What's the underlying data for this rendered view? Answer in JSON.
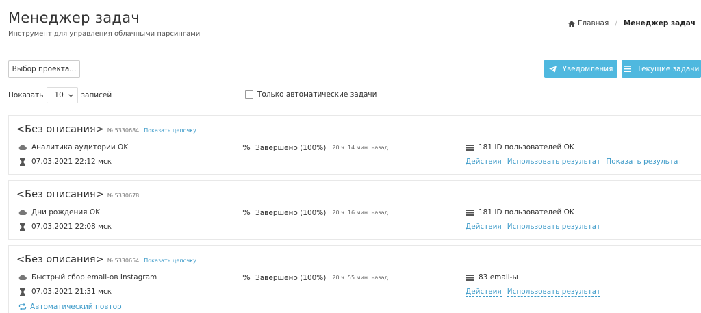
{
  "header": {
    "title": "Менеджер задач",
    "subtitle": "Инструмент для управления облачными парсингами",
    "breadcrumb": {
      "home": "Главная",
      "current": "Менеджер задач"
    }
  },
  "toolbar": {
    "project_button": "Выбор проекта...",
    "notifications_button": "Уведомления",
    "current_tasks_button": "Текущие задачи",
    "show_label": "Показать",
    "page_size": "10",
    "records_label": "записей",
    "auto_only_label": "Только автоматические задачи",
    "accent_color": "#4fb8df",
    "link_color": "#3e9bc9"
  },
  "tasks": [
    {
      "title": "<Без описания>",
      "number": "№ 5330684",
      "chain_link": "Показать цепочку",
      "tool": "Аналитика аудитории OK",
      "status": "Завершено (100%)",
      "ago": "20 ч. 14 мин. назад",
      "result": "181 ID пользователей OK",
      "datetime": "07.03.2021 22:12 мск",
      "actions": [
        "Действия",
        "Использовать результат",
        "Показать результат"
      ]
    },
    {
      "title": "<Без описания>",
      "number": "№ 5330678",
      "tool": "Дни рождения OK",
      "status": "Завершено (100%)",
      "ago": "20 ч. 16 мин. назад",
      "result": "181 ID пользователей OK",
      "datetime": "07.03.2021 22:08 мск",
      "actions": [
        "Действия",
        "Использовать результат"
      ]
    },
    {
      "title": "<Без описания>",
      "number": "№ 5330654",
      "chain_link": "Показать цепочку",
      "tool": "Быстрый сбор email-ов Instagram",
      "status": "Завершено (100%)",
      "ago": "20 ч. 55 мин. назад",
      "result": "83 email-ы",
      "datetime": "07.03.2021 21:31 мск",
      "actions": [
        "Действия",
        "Использовать результат"
      ],
      "repeat_label": "Автоматический повтор"
    }
  ]
}
